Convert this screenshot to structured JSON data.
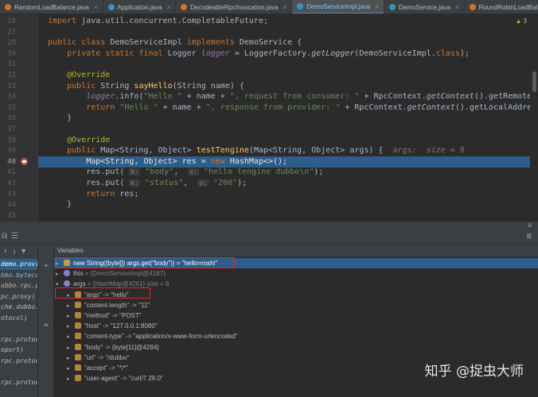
{
  "tabs": [
    {
      "label": "RandomLoadBalance.java",
      "kind": "java",
      "active": false
    },
    {
      "label": "Application.java",
      "kind": "cls",
      "active": false
    },
    {
      "label": "DecodeableRpcInvocation.java",
      "kind": "java",
      "active": false
    },
    {
      "label": "DemoServiceImpl.java",
      "kind": "cls",
      "active": true
    },
    {
      "label": "DemoService.java",
      "kind": "cls",
      "active": false
    },
    {
      "label": "RoundRobinLoadBalance.java",
      "kind": "java",
      "active": false
    },
    {
      "label": "NettyC",
      "kind": "java",
      "active": false
    }
  ],
  "editor": {
    "warning_count": "3",
    "lines": [
      {
        "n": "28",
        "html": "<span class=\"kw\">import</span> java.util.concurrent.CompletableFuture;"
      },
      {
        "n": "27",
        "html": ""
      },
      {
        "n": "29",
        "html": "<span class=\"kw\">public class</span> DemoServiceImpl <span class=\"kw\">implements</span> DemoService {"
      },
      {
        "n": "30",
        "html": "    <span class=\"kw\">private static final</span> Logger <span class=\"fld\">logger</span> = LoggerFactory.<span class=\"it\">getLogger</span>(DemoServiceImpl.<span class=\"kw\">class</span>);"
      },
      {
        "n": "31",
        "html": ""
      },
      {
        "n": "32",
        "html": "    <span class=\"ann\">@Override</span>"
      },
      {
        "n": "33",
        "html": "    <span class=\"kw\">public</span> String <span class=\"meth\">sayHello</span>(String name) {"
      },
      {
        "n": "34",
        "html": "        <span class=\"fld\">logger</span>.info(<span class=\"str\">\"Hello \"</span> + name + <span class=\"str\">\", request from consumer: \"</span> + RpcContext.<span class=\"it\">getContext</span>().getRemoteAddress());"
      },
      {
        "n": "35",
        "html": "        <span class=\"kw\">return</span> <span class=\"str\">\"Hello \"</span> + name + <span class=\"str\">\", response from provider: \"</span> + RpcContext.<span class=\"it\">getContext</span>().getLocalAddress();"
      },
      {
        "n": "36",
        "html": "    }"
      },
      {
        "n": "37",
        "html": ""
      },
      {
        "n": "38",
        "html": "    <span class=\"ann\">@Override</span>"
      },
      {
        "n": "39",
        "html": "    <span class=\"kw\">public</span> Map&lt;String, Object&gt; <span class=\"meth\">testTengine</span>(Map&lt;String, Object&gt; args) {  <span class=\"hint\">args:  size = 9</span>"
      },
      {
        "n": "40",
        "html": "        Map&lt;String, Object&gt; res = <span class=\"kw\">new</span> HashMap&lt;&gt;();",
        "exec": true
      },
      {
        "n": "41",
        "html": "        res.put( <span class=\"hintbox\">k:</span> <span class=\"str\">\"body\"</span>,  <span class=\"hintbox\">v:</span> <span class=\"str\">\"hello tengine dubbo\\n\"</span>);"
      },
      {
        "n": "42",
        "html": "        res.put( <span class=\"hintbox\">k:</span> <span class=\"str\">\"status\"</span>,  <span class=\"hintbox\">v:</span> <span class=\"str\">\"200\"</span>);"
      },
      {
        "n": "43",
        "html": "        <span class=\"kw\">return</span> res;"
      },
      {
        "n": "44",
        "html": "    }"
      },
      {
        "n": "45",
        "html": ""
      }
    ]
  },
  "frames": {
    "items": [
      {
        "label": "demo.provid",
        "selected": true
      },
      {
        "label": "ubbo.rpc.prox",
        "selected": false
      },
      {
        "label": "pc.proxy)",
        "selected": false
      },
      {
        "label": "che.dubbo.rpc",
        "selected": false
      },
      {
        "label": "otocol)",
        "selected": false
      },
      {
        "label": "",
        "selected": false
      },
      {
        "label": "rpc.protoc",
        "selected": false
      },
      {
        "label": "oport)",
        "selected": false
      },
      {
        "label": "rpc.protoc",
        "selected": false
      },
      {
        "label": "",
        "selected": false
      },
      {
        "label": "rpc.protoc",
        "selected": false
      },
      {
        "label": "",
        "selected": false
      }
    ],
    "highlight": "bbo.bytecode"
  },
  "variables": {
    "title": "Variables",
    "rows": [
      {
        "indent": 0,
        "icon": "o",
        "arrow": "",
        "name": "new String((byte[]) args.get(\"body\")) = \"hello=roshi\"",
        "selected": true
      },
      {
        "indent": 0,
        "icon": "p",
        "arrow": "▸",
        "name": "this",
        "value": " = {DemoServiceImpl@4187}"
      },
      {
        "indent": 0,
        "icon": "p",
        "arrow": "▾",
        "name": "args",
        "value": " = {HashMap@4261}  size = 9"
      },
      {
        "indent": 1,
        "icon": "f",
        "arrow": "▸",
        "name": "\"args\" -> \"hello\""
      },
      {
        "indent": 1,
        "icon": "f",
        "arrow": "▸",
        "name": "\"content-length\" -> \"11\""
      },
      {
        "indent": 1,
        "icon": "f",
        "arrow": "▸",
        "name": "\"method\" -> \"POST\""
      },
      {
        "indent": 1,
        "icon": "f",
        "arrow": "▸",
        "name": "\"host\" -> \"127.0.0.1:8080\""
      },
      {
        "indent": 1,
        "icon": "f",
        "arrow": "▸",
        "name": "\"content-type\" -> \"application/x-www-form-urlencoded\""
      },
      {
        "indent": 1,
        "icon": "f",
        "arrow": "▸",
        "name": "\"body\" -> {byte[11]@4284}"
      },
      {
        "indent": 1,
        "icon": "f",
        "arrow": "▸",
        "name": "\"uri\" -> \"/dubbo\""
      },
      {
        "indent": 1,
        "icon": "f",
        "arrow": "▸",
        "name": "\"accept\" -> \"*/*\""
      },
      {
        "indent": 1,
        "icon": "f",
        "arrow": "▸",
        "name": "\"user-agent\" -> \"curl/7.29.0\""
      }
    ]
  },
  "watermark": "知乎 @捉虫大师"
}
